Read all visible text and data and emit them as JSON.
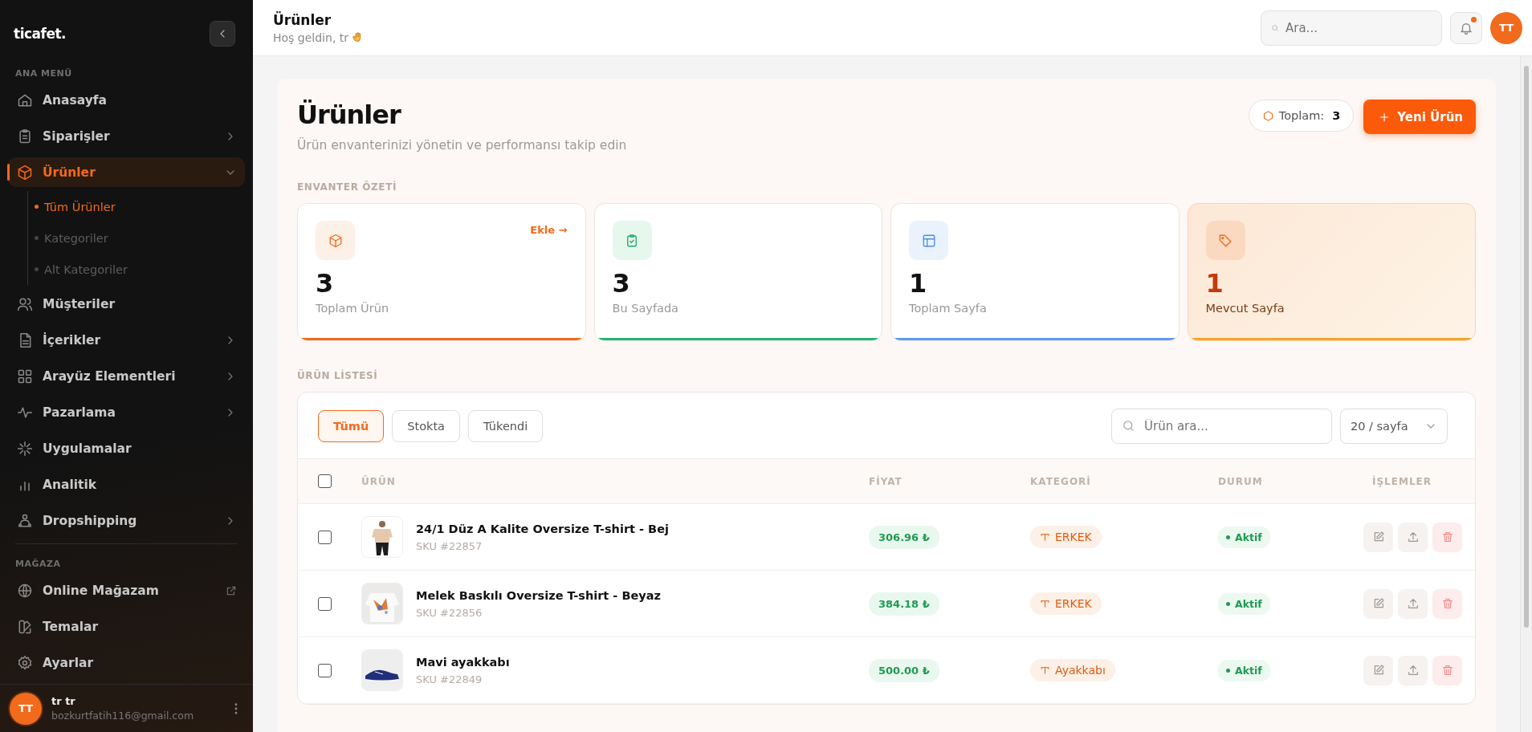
{
  "sidebar": {
    "logo": "ticafet.",
    "sections": [
      {
        "title": "ANA MENÜ",
        "items": [
          {
            "label": "Anasayfa",
            "selected": false,
            "has_submenu": false
          },
          {
            "label": "Siparişler",
            "selected": false,
            "has_submenu": true
          },
          {
            "label": "Ürünler",
            "selected": true,
            "has_submenu": true,
            "expanded": true,
            "children": [
              {
                "label": "Tüm Ürünler",
                "selected": true
              },
              {
                "label": "Kategoriler",
                "selected": false
              },
              {
                "label": "Alt Kategoriler",
                "selected": false
              }
            ]
          },
          {
            "label": "Müşteriler",
            "selected": false,
            "has_submenu": false
          },
          {
            "label": "İçerikler",
            "selected": false,
            "has_submenu": true
          },
          {
            "label": "Arayüz Elementleri",
            "selected": false,
            "has_submenu": true
          },
          {
            "label": "Pazarlama",
            "selected": false,
            "has_submenu": true
          },
          {
            "label": "Uygulamalar",
            "selected": false,
            "has_submenu": false
          },
          {
            "label": "Analitik",
            "selected": false,
            "has_submenu": false
          },
          {
            "label": "Dropshipping",
            "selected": false,
            "has_submenu": true
          }
        ]
      },
      {
        "title": "MAĞAZA",
        "items": [
          {
            "label": "Online Mağazam",
            "selected": false,
            "has_submenu": false,
            "external": true
          },
          {
            "label": "Temalar",
            "selected": false,
            "has_submenu": false
          },
          {
            "label": "Ayarlar",
            "selected": false,
            "has_submenu": false
          }
        ]
      }
    ],
    "user": {
      "initials": "TT",
      "name": "tr tr",
      "email": "bozkurtfatih116@gmail.com"
    }
  },
  "header": {
    "title": "Ürünler",
    "subtitle": "Hoş geldin, tr",
    "search": {
      "placeholder": "Ara..."
    },
    "notification": true,
    "avatar": "TT"
  },
  "page": {
    "title": "Ürünler",
    "subtitle": "Ürün envanterinizi yönetin ve performansı takip edin",
    "total_label": "Toplam:",
    "total_value": "3",
    "new_button": "Yeni Ürün"
  },
  "summary": {
    "title": "ENVANTER ÖZETİ",
    "cards": [
      {
        "value": "3",
        "label": "Toplam Ürün",
        "link": "Ekle →",
        "color": "#f26a1b",
        "highlighted": false
      },
      {
        "value": "3",
        "label": "Bu Sayfada",
        "color": "#22b573",
        "highlighted": false
      },
      {
        "value": "1",
        "label": "Toplam Sayfa",
        "color": "#5b9cf0",
        "highlighted": false
      },
      {
        "value": "1",
        "label": "Mevcut Sayfa",
        "color": "#f5a623",
        "highlighted": true
      }
    ]
  },
  "list": {
    "title": "ÜRÜN LİSTESİ",
    "filters": [
      {
        "label": "Tümü",
        "selected": true
      },
      {
        "label": "Stokta",
        "selected": false
      },
      {
        "label": "Tükendi",
        "selected": false
      }
    ],
    "search": {
      "placeholder": "Ürün ara..."
    },
    "page_size": "20 / sayfa",
    "table": {
      "columns": [
        "ÜRÜN",
        "FİYAT",
        "KATEGORİ",
        "DURUM",
        "İŞLEMLER"
      ],
      "all_checked": false,
      "rows": [
        {
          "checked": false,
          "name": "24/1 Düz A Kalite Oversize T-shirt - Bej",
          "sku": "SKU #22857",
          "price": "306.96 ₺",
          "category": "ERKEK",
          "status": "Aktif"
        },
        {
          "checked": false,
          "name": "Melek Baskılı Oversize T-shirt - Beyaz",
          "sku": "SKU #22856",
          "price": "384.18 ₺",
          "category": "ERKEK",
          "status": "Aktif"
        },
        {
          "checked": false,
          "name": "Mavi ayakkabı",
          "sku": "SKU #22849",
          "price": "500.00 ₺",
          "category": "Ayakkabı",
          "status": "Aktif"
        }
      ]
    }
  }
}
